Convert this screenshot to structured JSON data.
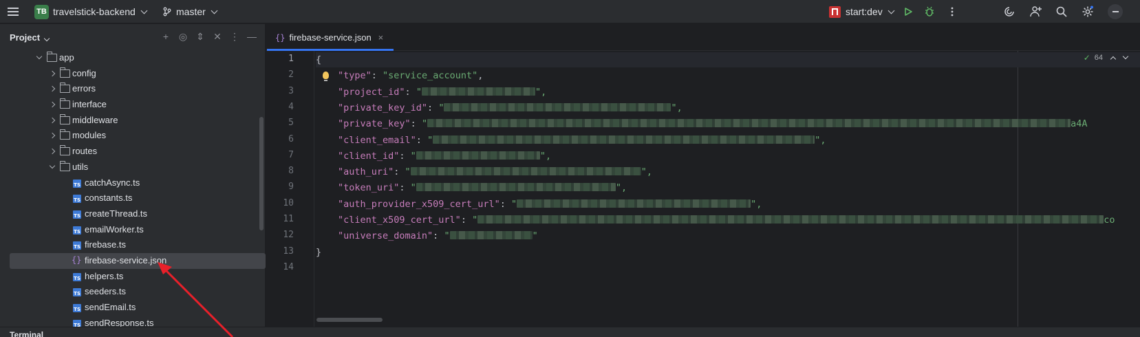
{
  "toolbar": {
    "project_badge": "TB",
    "project_name": "travelstick-backend",
    "branch": "master",
    "run_config": "start:dev"
  },
  "project_panel": {
    "title": "Project",
    "tree": [
      {
        "label": "app",
        "kind": "folder",
        "expanded": true,
        "depth": 0
      },
      {
        "label": "config",
        "kind": "folder",
        "expanded": false,
        "depth": 1
      },
      {
        "label": "errors",
        "kind": "folder",
        "expanded": false,
        "depth": 1
      },
      {
        "label": "interface",
        "kind": "folder",
        "expanded": false,
        "depth": 1
      },
      {
        "label": "middleware",
        "kind": "folder",
        "expanded": false,
        "depth": 1
      },
      {
        "label": "modules",
        "kind": "folder",
        "expanded": false,
        "depth": 1
      },
      {
        "label": "routes",
        "kind": "folder",
        "expanded": false,
        "depth": 1
      },
      {
        "label": "utils",
        "kind": "folder",
        "expanded": true,
        "depth": 1
      },
      {
        "label": "catchAsync.ts",
        "kind": "ts",
        "depth": 2
      },
      {
        "label": "constants.ts",
        "kind": "ts",
        "depth": 2
      },
      {
        "label": "createThread.ts",
        "kind": "ts",
        "depth": 2
      },
      {
        "label": "emailWorker.ts",
        "kind": "ts",
        "depth": 2
      },
      {
        "label": "firebase.ts",
        "kind": "ts",
        "depth": 2
      },
      {
        "label": "firebase-service.json",
        "kind": "json",
        "depth": 2,
        "selected": true
      },
      {
        "label": "helpers.ts",
        "kind": "ts",
        "depth": 2
      },
      {
        "label": "seeders.ts",
        "kind": "ts",
        "depth": 2
      },
      {
        "label": "sendEmail.ts",
        "kind": "ts",
        "depth": 2
      },
      {
        "label": "sendResponse.ts",
        "kind": "ts",
        "depth": 2
      }
    ]
  },
  "editor": {
    "tab_label": "firebase-service.json",
    "tab_icon": "{}",
    "inspection_count": "64",
    "line_numbers": [
      "1",
      "2",
      "3",
      "4",
      "5",
      "6",
      "7",
      "8",
      "9",
      "10",
      "11",
      "12",
      "13",
      "14"
    ],
    "lines": [
      {
        "text": "{"
      },
      {
        "key": "\"type\"",
        "value": "\"service_account\"",
        "trail": ","
      },
      {
        "key": "\"project_id\"",
        "value_open": "\"",
        "trail": "\","
      },
      {
        "key": "\"private_key_id\"",
        "value_open": "\"",
        "trail": "\","
      },
      {
        "key": "\"private_key\"",
        "value_open": "\"",
        "tail_visible": "a4A"
      },
      {
        "key": "\"client_email\"",
        "value_open": "\"",
        "trail": "\","
      },
      {
        "key": "\"client_id\"",
        "value_open": "\"",
        "trail": "\","
      },
      {
        "key": "\"auth_uri\"",
        "value_open": "\"",
        "trail": "\","
      },
      {
        "key": "\"token_uri\"",
        "value_open": "\"",
        "trail": "\","
      },
      {
        "key": "\"auth_provider_x509_cert_url\"",
        "value_open": "\"",
        "trail": "\","
      },
      {
        "key": "\"client_x509_cert_url\"",
        "value_open": "\"",
        "tail_visible": "co"
      },
      {
        "key": "\"universe_domain\"",
        "value_open": "\"",
        "trail": "\""
      },
      {
        "text": "}"
      },
      {
        "text": ""
      }
    ]
  },
  "bottom_panel": {
    "label": "Terminal"
  },
  "colors": {
    "accent": "#3574f0",
    "annotation_arrow": "#e8202a",
    "json_key": "#c77dbb",
    "json_string": "#6aab73"
  }
}
